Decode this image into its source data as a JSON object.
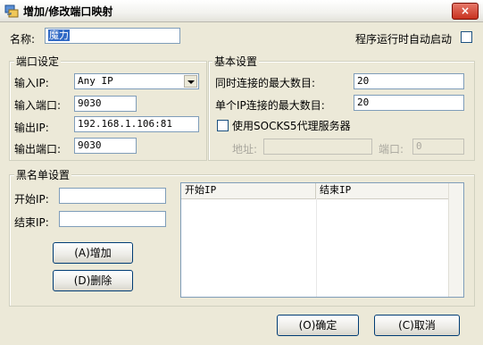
{
  "window": {
    "title": "增加/修改端口映射",
    "close_label": "×"
  },
  "name_row": {
    "label": "名称:",
    "value": "魔力"
  },
  "autostart": {
    "label": "程序运行时自动启动",
    "checked": false
  },
  "port_settings": {
    "title": "端口设定",
    "input_ip_label": "输入IP:",
    "input_ip_value": "Any IP",
    "input_port_label": "输入端口:",
    "input_port_value": "9030",
    "output_ip_label": "输出IP:",
    "output_ip_value": "192.168.1.106:81",
    "output_port_label": "输出端口:",
    "output_port_value": "9030"
  },
  "basic_settings": {
    "title": "基本设置",
    "max_connections_label": "同时连接的最大数目:",
    "max_connections_value": "20",
    "max_per_ip_label": "单个IP连接的最大数目:",
    "max_per_ip_value": "20",
    "socks5_label": "使用SOCKS5代理服务器",
    "socks5_checked": false,
    "address_label": "地址:",
    "address_value": "",
    "port_label": "端口:",
    "port_value": "0"
  },
  "blacklist": {
    "title": "黑名单设置",
    "start_ip_label": "开始IP:",
    "start_ip_value": "",
    "end_ip_label": "结束IP:",
    "end_ip_value": "",
    "add_button": "(A)增加",
    "delete_button": "(D)删除",
    "columns": [
      "开始IP",
      "结束IP"
    ]
  },
  "footer": {
    "ok_button": "(O)确定",
    "cancel_button": "(C)取消"
  }
}
